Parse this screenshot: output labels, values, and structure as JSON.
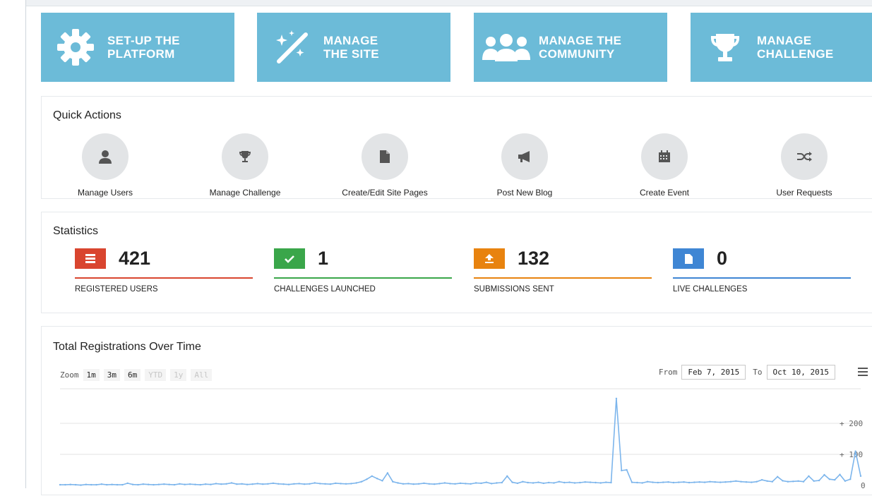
{
  "tiles": [
    {
      "label": "SET-UP THE\nPLATFORM",
      "icon": "gear-icon"
    },
    {
      "label": "MANAGE\nTHE SITE",
      "icon": "magic-wand-icon"
    },
    {
      "label": "MANAGE THE\nCOMMUNITY",
      "icon": "users-group-icon"
    },
    {
      "label": "MANAGE\nCHALLENGE",
      "icon": "trophy-icon"
    }
  ],
  "quick_actions": {
    "title": "Quick Actions",
    "items": [
      {
        "label": "Manage Users",
        "icon": "user-icon"
      },
      {
        "label": "Manage Challenge",
        "icon": "trophy-icon"
      },
      {
        "label": "Create/Edit Site Pages",
        "icon": "page-icon"
      },
      {
        "label": "Post New Blog",
        "icon": "megaphone-icon"
      },
      {
        "label": "Create Event",
        "icon": "calendar-icon"
      },
      {
        "label": "User Requests",
        "icon": "shuffle-icon"
      }
    ]
  },
  "statistics": {
    "title": "Statistics",
    "items": [
      {
        "value": "421",
        "label": "REGISTERED USERS",
        "color": "#d9452f",
        "icon": "server-icon"
      },
      {
        "value": "1",
        "label": "CHALLENGES LAUNCHED",
        "color": "#3aa64a",
        "icon": "checkmark-icon"
      },
      {
        "value": "132",
        "label": "SUBMISSIONS SENT",
        "color": "#e8830f",
        "icon": "upload-icon"
      },
      {
        "value": "0",
        "label": "LIVE CHALLENGES",
        "color": "#3f86d4",
        "icon": "document-icon"
      }
    ]
  },
  "chart_panel": {
    "title": "Total Registrations Over Time",
    "zoom_label": "Zoom",
    "zoom_buttons": [
      {
        "label": "1m",
        "enabled": true
      },
      {
        "label": "3m",
        "enabled": true
      },
      {
        "label": "6m",
        "enabled": true
      },
      {
        "label": "YTD",
        "enabled": false
      },
      {
        "label": "1y",
        "enabled": false
      },
      {
        "label": "All",
        "enabled": false
      }
    ],
    "from_label": "From",
    "from_value": "Feb 7, 2015",
    "to_label": "To",
    "to_value": "Oct 10, 2015"
  },
  "colors": {
    "tile": "#6cbbd8",
    "line": "#7cb5ec"
  },
  "chart_data": {
    "type": "line",
    "title": "Total Registrations Over Time",
    "y_tick_labels": [
      "0",
      "100",
      "200"
    ],
    "ylim": [
      0,
      300
    ],
    "grid": true,
    "x_range": [
      "Feb 7, 2015",
      "Oct 10, 2015"
    ],
    "values": [
      2,
      2,
      3,
      2,
      1,
      3,
      2,
      2,
      4,
      2,
      3,
      2,
      2,
      7,
      3,
      2,
      4,
      3,
      2,
      3,
      4,
      3,
      2,
      5,
      3,
      4,
      3,
      2,
      4,
      3,
      6,
      4,
      5,
      8,
      4,
      5,
      3,
      4,
      6,
      4,
      5,
      7,
      5,
      4,
      3,
      5,
      6,
      4,
      5,
      8,
      6,
      5,
      4,
      7,
      6,
      5,
      6,
      8,
      12,
      20,
      30,
      22,
      15,
      40,
      12,
      8,
      5,
      6,
      4,
      5,
      7,
      5,
      4,
      6,
      8,
      6,
      5,
      7,
      6,
      5,
      8,
      7,
      10,
      6,
      8,
      9,
      30,
      10,
      7,
      12,
      9,
      8,
      10,
      7,
      9,
      8,
      12,
      9,
      10,
      8,
      9,
      11,
      10,
      9,
      8,
      10,
      9,
      280,
      48,
      50,
      10,
      9,
      8,
      12,
      10,
      9,
      10,
      11,
      9,
      10,
      11,
      9,
      10,
      11,
      10,
      12,
      11,
      10,
      11,
      12,
      14,
      12,
      11,
      10,
      12,
      18,
      14,
      12,
      28,
      15,
      12,
      13,
      14,
      12,
      30,
      14,
      16,
      34,
      20,
      18,
      35,
      14,
      20,
      110,
      30
    ]
  }
}
